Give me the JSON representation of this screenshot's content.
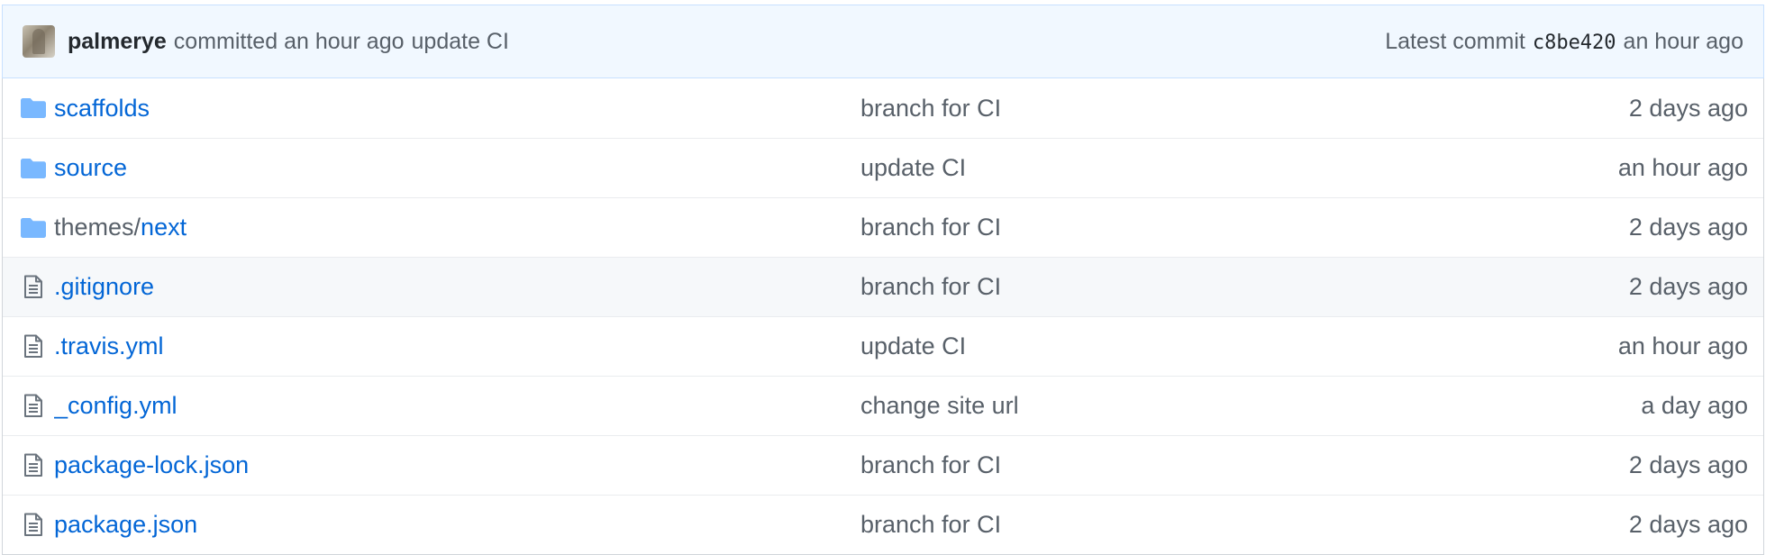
{
  "commit": {
    "author": "palmerye",
    "verb": "committed",
    "time": "an hour ago",
    "message": "update CI",
    "latest_label": "Latest commit",
    "sha": "c8be420",
    "latest_time": "an hour ago"
  },
  "files": [
    {
      "type": "folder",
      "icon": "folder-icon",
      "prefix": "",
      "name": "scaffolds",
      "message": "branch for CI",
      "age": "2 days ago"
    },
    {
      "type": "folder",
      "icon": "folder-icon",
      "prefix": "",
      "name": "source",
      "message": "update CI",
      "age": "an hour ago"
    },
    {
      "type": "folder",
      "icon": "folder-icon",
      "prefix": "themes/",
      "name": "next",
      "message": "branch for CI",
      "age": "2 days ago"
    },
    {
      "type": "file",
      "icon": "file-icon",
      "prefix": "",
      "name": ".gitignore",
      "message": "branch for CI",
      "age": "2 days ago"
    },
    {
      "type": "file",
      "icon": "file-icon",
      "prefix": "",
      "name": ".travis.yml",
      "message": "update CI",
      "age": "an hour ago"
    },
    {
      "type": "file",
      "icon": "file-icon",
      "prefix": "",
      "name": "_config.yml",
      "message": "change site url",
      "age": "a day ago"
    },
    {
      "type": "file",
      "icon": "file-icon",
      "prefix": "",
      "name": "package-lock.json",
      "message": "branch for CI",
      "age": "2 days ago"
    },
    {
      "type": "file",
      "icon": "file-icon",
      "prefix": "",
      "name": "package.json",
      "message": "branch for CI",
      "age": "2 days ago"
    }
  ],
  "colors": {
    "link": "#0366d6",
    "muted": "#586069",
    "commit_bar_bg": "#f1f8ff",
    "folder_icon": "#79b8ff"
  }
}
